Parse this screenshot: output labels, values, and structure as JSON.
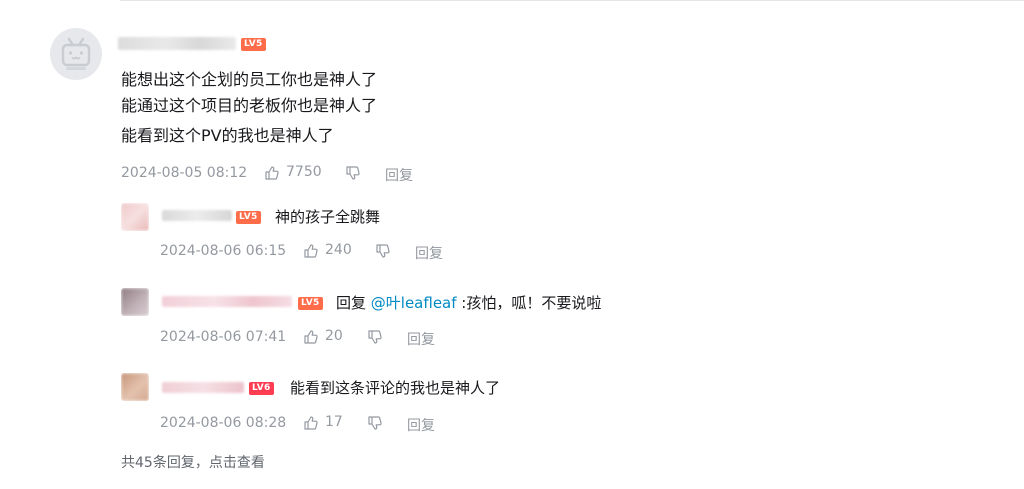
{
  "main_comment": {
    "level": "LV5",
    "lines": [
      "能想出这个企划的员工你也是神人了",
      "能通过这个项目的老板你也是神人了",
      "能看到这个PV的我也是神人了"
    ],
    "date": "2024-08-05 08:12",
    "likes": "7750",
    "reply_label": "回复"
  },
  "replies": [
    {
      "level": "LV5",
      "prefix": "",
      "mention": "",
      "text": "神的孩子全跳舞",
      "date": "2024-08-06 06:15",
      "likes": "240",
      "reply_label": "回复"
    },
    {
      "level": "LV5",
      "prefix": "回复 ",
      "mention": "@叶leafleaf",
      "text": " :孩怕，呱！不要说啦",
      "date": "2024-08-06 07:41",
      "likes": "20",
      "reply_label": "回复"
    },
    {
      "level": "LV6",
      "prefix": "",
      "mention": "",
      "text": "能看到这条评论的我也是神人了",
      "date": "2024-08-06 08:28",
      "likes": "17",
      "reply_label": "回复"
    }
  ],
  "footer": {
    "view_more": "共45条回复，点击查看"
  },
  "colors": {
    "mention": "#008ac5",
    "meta": "#9499a0",
    "level_badge": "#ff6c4a"
  }
}
